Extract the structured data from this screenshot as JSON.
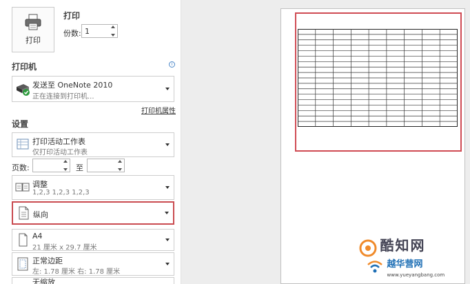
{
  "print": {
    "button_label": "打印",
    "title": "打印",
    "copies_label": "份数:",
    "copies_value": "1"
  },
  "printer": {
    "section_title": "打印机",
    "name": "发送至 OneNote 2010",
    "status": "正在连接到打印机...",
    "properties_link": "打印机属性"
  },
  "settings": {
    "section_title": "设置",
    "scope": {
      "title": "打印活动工作表",
      "subtitle": "仅打印活动工作表"
    },
    "pages_label": "页数:",
    "pages_to_label": "至",
    "pages_from": "",
    "pages_to": "",
    "collate": {
      "title": "调整",
      "subtitle": "1,2,3    1,2,3    1,2,3"
    },
    "orientation": {
      "title": "纵向"
    },
    "paper": {
      "title": "A4",
      "subtitle": "21 厘米 x 29.7 厘米"
    },
    "margins": {
      "title": "正常边距",
      "subtitle": "左: 1.78 厘米    右: 1.78 厘米"
    },
    "scaling": {
      "title": "无缩放"
    }
  },
  "watermark": {
    "brand1": "酷知网",
    "brand2": "越华营网",
    "url": "www.yueyangbang.com"
  },
  "colors": {
    "highlight": "#c94a4f",
    "accent": "#1e6fb5"
  }
}
